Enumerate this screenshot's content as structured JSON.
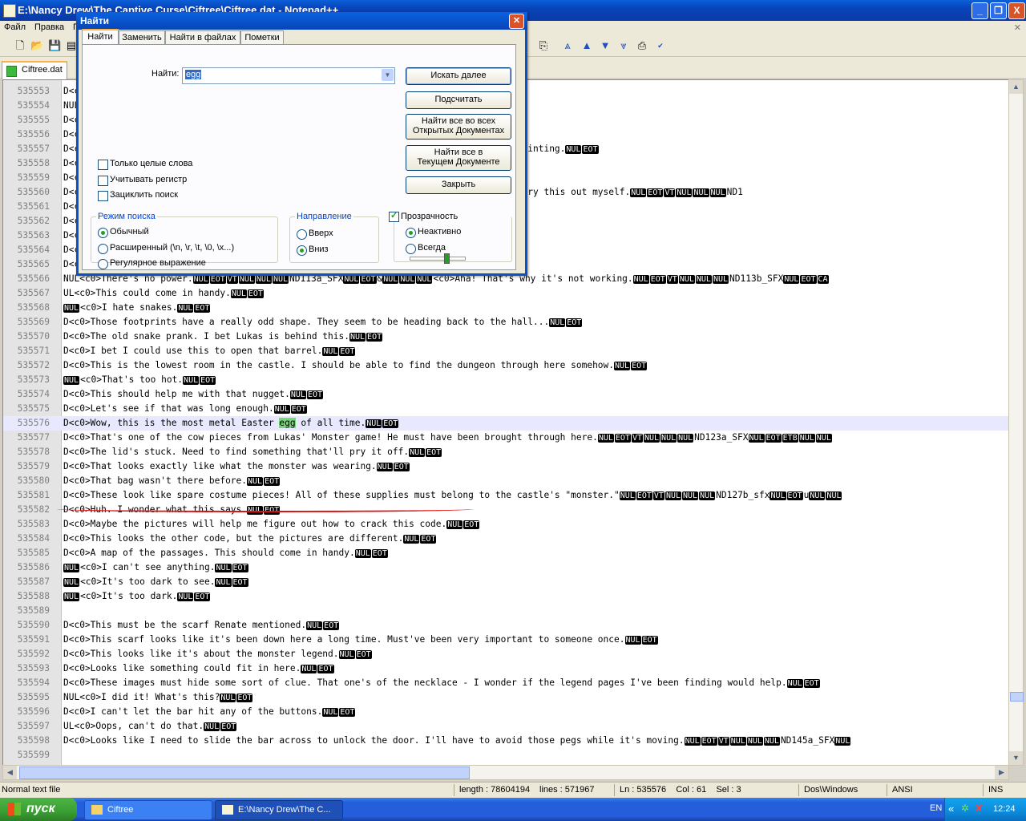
{
  "window": {
    "title": "E:\\Nancy Drew\\The Captive Curse\\Ciftree\\Ciftree.dat - Notepad++",
    "controls": [
      "_",
      "❐",
      "X"
    ]
  },
  "menu": [
    "Файл",
    "Правка",
    "Г"
  ],
  "tab": {
    "label": "Ciftree.dat"
  },
  "editor": {
    "current_line_index": 23,
    "lines": [
      {
        "n": "535553",
        "t": "D<c0"
      },
      {
        "n": "535554",
        "t": "NUL"
      },
      {
        "n": "535555",
        "t": "D<c0"
      },
      {
        "n": "535556",
        "t": "D<c0"
      },
      {
        "n": "535557",
        "t": "D<c0                                                 d an undamaged version of this painting.[NUL][EOT]"
      },
      {
        "n": "535558",
        "t": "D<c0"
      },
      {
        "n": "535559",
        "t": "D<c0"
      },
      {
        "n": "535560",
        "t": "D<c0                                                 opened the clocks. I'll need to try this out myself.[NUL][EOT][VT][NUL][NUL][NUL]ND1"
      },
      {
        "n": "535561",
        "t": "D<c0"
      },
      {
        "n": "535562",
        "t": "D<c0                                                                 t.[NUL][EOT]"
      },
      {
        "n": "535563",
        "t": "D<c0"
      },
      {
        "n": "535564",
        "t": "D<c0                                                 ng about.[NUL][EOT]"
      },
      {
        "n": "535565",
        "t": "D<c0"
      },
      {
        "n": "535566",
        "t": "NUL<c0>There's no power.[NUL][EOT][VT][NUL][NUL][NUL]ND113a_SFX[NUL][EOT]&[NUL][NUL][NUL]<c0>Aha! That's why it's not working.[NUL][EOT][VT][NUL][NUL][NUL]ND113b_SFX[NUL][EOT][CA]"
      },
      {
        "n": "535567",
        "t": "UL<c0>This could come in handy.[NUL][EOT]"
      },
      {
        "n": "535568",
        "t": "[NUL]<c0>I hate snakes.[NUL][EOT]"
      },
      {
        "n": "535569",
        "t": "D<c0>Those footprints have a really odd shape. They seem to be heading back to the hall...[NUL][EOT]"
      },
      {
        "n": "535570",
        "t": "D<c0>The old snake prank. I bet Lukas is behind this.[NUL][EOT]"
      },
      {
        "n": "535571",
        "t": "D<c0>I bet I could use this to open that barrel.[NUL][EOT]"
      },
      {
        "n": "535572",
        "t": "D<c0>This is the lowest room in the castle. I should be able to find the dungeon through here somehow.[NUL][EOT]"
      },
      {
        "n": "535573",
        "t": "[NUL]<c0>That's too hot.[NUL][EOT]"
      },
      {
        "n": "535574",
        "t": "D<c0>This should help me with that nugget.[NUL][EOT]"
      },
      {
        "n": "535575",
        "t": "D<c0>Let's see if that was long enough.[NUL][EOT]"
      },
      {
        "n": "535576",
        "t": "D<c0>Wow, this is the most metal Easter {egg} of all time.[NUL][EOT]"
      },
      {
        "n": "535577",
        "t": "D<c0>That's one of the cow pieces from Lukas' Monster game! He must have been brought through here.[NUL][EOT][VT][NUL][NUL][NUL]ND123a_SFX[NUL][EOT][ETB][NUL][NUL]"
      },
      {
        "n": "535578",
        "t": "D<c0>The lid's stuck. Need to find something that'll pry it off.[NUL][EOT]"
      },
      {
        "n": "535579",
        "t": "D<c0>That looks exactly like what the monster was wearing.[NUL][EOT]"
      },
      {
        "n": "535580",
        "t": "D<c0>That bag wasn't there before.[NUL][EOT]"
      },
      {
        "n": "535581",
        "t": "D<c0>These look like spare costume pieces! All of these supplies must belong to the castle's \"monster.\"[NUL][EOT][VT][NUL][NUL][NUL]ND127b_sfx[NUL][EOT]u[NUL][NUL]"
      },
      {
        "n": "535582",
        "t": "D<c0>Huh. I wonder what this says.[NUL][EOT]"
      },
      {
        "n": "535583",
        "t": "D<c0>Maybe the pictures will help me figure out how to crack this code.[NUL][EOT]"
      },
      {
        "n": "535584",
        "t": "D<c0>This looks the other code, but the pictures are different.[NUL][EOT]"
      },
      {
        "n": "535585",
        "t": "D<c0>A map of the passages. This should come in handy.[NUL][EOT]"
      },
      {
        "n": "535586",
        "t": "[NUL]<c0>I can't see anything.[NUL][EOT]"
      },
      {
        "n": "535587",
        "t": "[NUL]<c0>It's too dark to see.[NUL][EOT]"
      },
      {
        "n": "535588",
        "t": "[NUL]<c0>It's too dark.[NUL][EOT]"
      },
      {
        "n": "535589",
        "t": ""
      },
      {
        "n": "535590",
        "t": "D<c0>This must be the scarf Renate mentioned.[NUL][EOT]"
      },
      {
        "n": "535591",
        "t": "D<c0>This scarf looks like it's been down here a long time. Must've been very important to someone once.[NUL][EOT]"
      },
      {
        "n": "535592",
        "t": "D<c0>This looks like it's about the monster legend.[NUL][EOT]"
      },
      {
        "n": "535593",
        "t": "D<c0>Looks like something could fit in here.[NUL][EOT]"
      },
      {
        "n": "535594",
        "t": "D<c0>These images must hide some sort of clue. That one's of the necklace - I wonder if the legend pages I've been finding would help.[NUL][EOT]"
      },
      {
        "n": "535595",
        "t": "NUL<c0>I did it! What's this?[NUL][EOT]"
      },
      {
        "n": "535596",
        "t": "D<c0>I can't let the bar hit any of the buttons.[NUL][EOT]"
      },
      {
        "n": "535597",
        "t": "UL<c0>Oops, can't do that.[NUL][EOT]"
      },
      {
        "n": "535598",
        "t": "D<c0>Looks like I need to slide the bar across to unlock the door. I'll have to avoid those pegs while it's moving.[NUL][EOT][VT][NUL][NUL][NUL]ND145a_SFX[NUL]"
      },
      {
        "n": "535599",
        "t": ""
      }
    ]
  },
  "status": {
    "type": "Normal text file",
    "length": "length : 78604194",
    "lines": "lines : 571967",
    "pos": "Ln : 535576    Col : 61    Sel : 3",
    "eol": "Dos\\Windows",
    "enc": "ANSI",
    "mode": "INS"
  },
  "taskbar": {
    "start": "пуск",
    "items": [
      "Ciftree",
      "E:\\Nancy Drew\\The C..."
    ],
    "lang": "EN",
    "clock": "12:24"
  },
  "find_dialog": {
    "title": "Найти",
    "tabs": [
      "Найти",
      "Заменить",
      "Найти в файлах",
      "Пометки"
    ],
    "find_label": "Найти:",
    "find_value": "egg",
    "buttons": {
      "find_next": "Искать далее",
      "count": "Подсчитать",
      "find_all_open_1": "Найти все во всех",
      "find_all_open_2": "Открытых Документах",
      "find_all_current_1": "Найти все в",
      "find_all_current_2": "Текущем Документе",
      "close": "Закрыть"
    },
    "options": {
      "whole_word": "Только целые слова",
      "match_case": "Учитывать регистр",
      "wrap": "Зациклить поиск"
    },
    "search_mode": {
      "title": "Режим поиска",
      "normal": "Обычный",
      "extended": "Расширенный (\\n, \\r, \\t, \\0, \\x...)",
      "regex": "Регулярное выражение"
    },
    "direction": {
      "title": "Направление",
      "up": "Вверх",
      "down": "Вниз"
    },
    "transparency": {
      "title": "Прозрачность",
      "inactive": "Неактивно",
      "always": "Всегда",
      "level": 0.6
    }
  }
}
